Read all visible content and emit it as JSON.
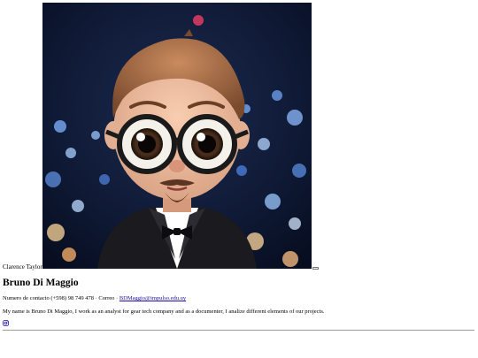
{
  "photo": {
    "caption": "Clarence Taylor",
    "image_description_icon": "avatar-portrait"
  },
  "profile": {
    "name": "Bruno Di Maggio",
    "contact_prefix": "Numero de contacto (+598) 98 749 478 · Correo · ",
    "email": "BDMaggio@impulso.edu.uy",
    "bio": "My name is Bruno Di Maggio, I work as an analyst for gear tech company and as a documenter, I analize different elements of our projects."
  },
  "social": {
    "icon": "instagram-icon"
  },
  "colors": {
    "link": "#1a0dab",
    "divider": "#9a9a9a"
  }
}
